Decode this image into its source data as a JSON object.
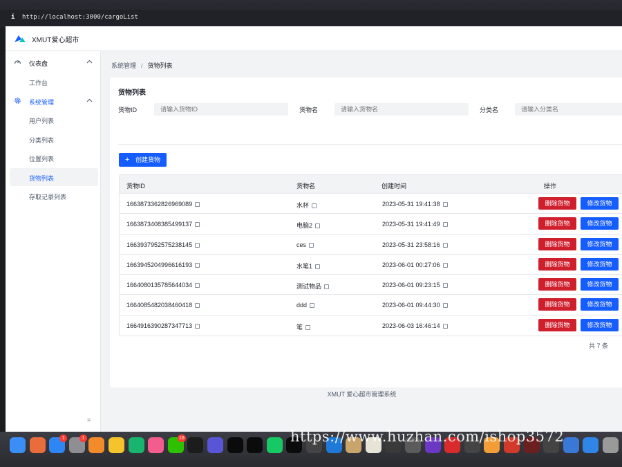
{
  "browser": {
    "url": "http://localhost:3000/cargoList",
    "info_glyph": "i"
  },
  "app": {
    "title": "XMUT爱心超市"
  },
  "sidebar": {
    "groups": [
      {
        "label": "仪表盘",
        "icon": "dashboard-icon",
        "items": [
          "工作台"
        ]
      },
      {
        "label": "系统管理",
        "icon": "gear-icon",
        "items": [
          "用户列表",
          "分类列表",
          "位置列表",
          "货物列表",
          "存取记录列表"
        ]
      }
    ],
    "selected": "货物列表",
    "collapse_glyph": "≡"
  },
  "breadcrumb": {
    "parent": "系统管理",
    "separator": "/",
    "current": "货物列表"
  },
  "page": {
    "title": "货物列表",
    "filters": [
      {
        "label": "货物ID",
        "placeholder": "请输入货物ID"
      },
      {
        "label": "货物名",
        "placeholder": "请输入货物名"
      },
      {
        "label": "分类名",
        "placeholder": "请输入分类名"
      }
    ],
    "create_button": "创建货物",
    "create_plus": "+"
  },
  "table": {
    "headers": [
      "货物ID",
      "货物名",
      "创建时间",
      "操作"
    ],
    "rows": [
      {
        "id": "1663873362826969089",
        "name": "水杯",
        "created": "2023-05-31 19:41:38"
      },
      {
        "id": "1663873408385499137",
        "name": "电脑2",
        "created": "2023-05-31 19:41:49"
      },
      {
        "id": "1663937952575238145",
        "name": "ces",
        "created": "2023-05-31 23:58:16"
      },
      {
        "id": "1663945204996616193",
        "name": "水笔1",
        "created": "2023-06-01 00:27:06"
      },
      {
        "id": "1664080135785644034",
        "name": "测试物品",
        "created": "2023-06-01 09:23:15"
      },
      {
        "id": "1664085482038460418",
        "name": "ddd",
        "created": "2023-06-01 09:44:30"
      },
      {
        "id": "1664916390287347713",
        "name": "笔",
        "created": "2023-06-03 16:46:14"
      }
    ],
    "delete_label": "删除货物",
    "edit_label": "修改货物",
    "total": "共 7 条"
  },
  "footer": "XMUT 爱心超市管理系统",
  "dock": {
    "icons": [
      "finder-icon",
      "launchpad-icon",
      "app-store-icon",
      "system-preferences-icon",
      "infuse-icon",
      "qq-music-icon",
      "iqiyi-icon",
      "bilibili-icon",
      "wechat-icon",
      "qq-icon",
      "app-icon",
      "goland-icon",
      "intellij-icon",
      "pycharm-icon",
      "webstorm-icon",
      "app-icon",
      "vscode-icon",
      "app-icon",
      "app-icon",
      "app-icon",
      "app-icon",
      "app-icon",
      "app-icon",
      "app-icon",
      "app-icon",
      "app-icon",
      "app-icon",
      "app-icon",
      "app-icon",
      "safari-icon",
      "trash-icon"
    ],
    "badges": [
      "1",
      "1",
      "16"
    ],
    "colors": [
      "#3b8ef5",
      "#e96c3c",
      "#2e86f5",
      "#8e8e93",
      "#f48b2b",
      "#f5c32b",
      "#19b46e",
      "#f25d8e",
      "#2dc100",
      "#1c1c1c",
      "#5856d6",
      "#0b0b0b",
      "#0b0b0b",
      "#17c964",
      "#0b0b0b",
      "#444",
      "#1e7ad6",
      "#c9a56b",
      "#e7e3d5",
      "#3a3a3a",
      "#5b5b5b",
      "#6a38c2",
      "#d92b2b",
      "#444",
      "#f29d38",
      "#d13a2a",
      "#6b1f1f",
      "#444",
      "#3a78d6",
      "#2f86e8",
      "#9a9a9a"
    ]
  },
  "watermark": "https://www.huzhan.com/ishop3572",
  "accent": "#165dff",
  "danger": "#cf1f2d"
}
